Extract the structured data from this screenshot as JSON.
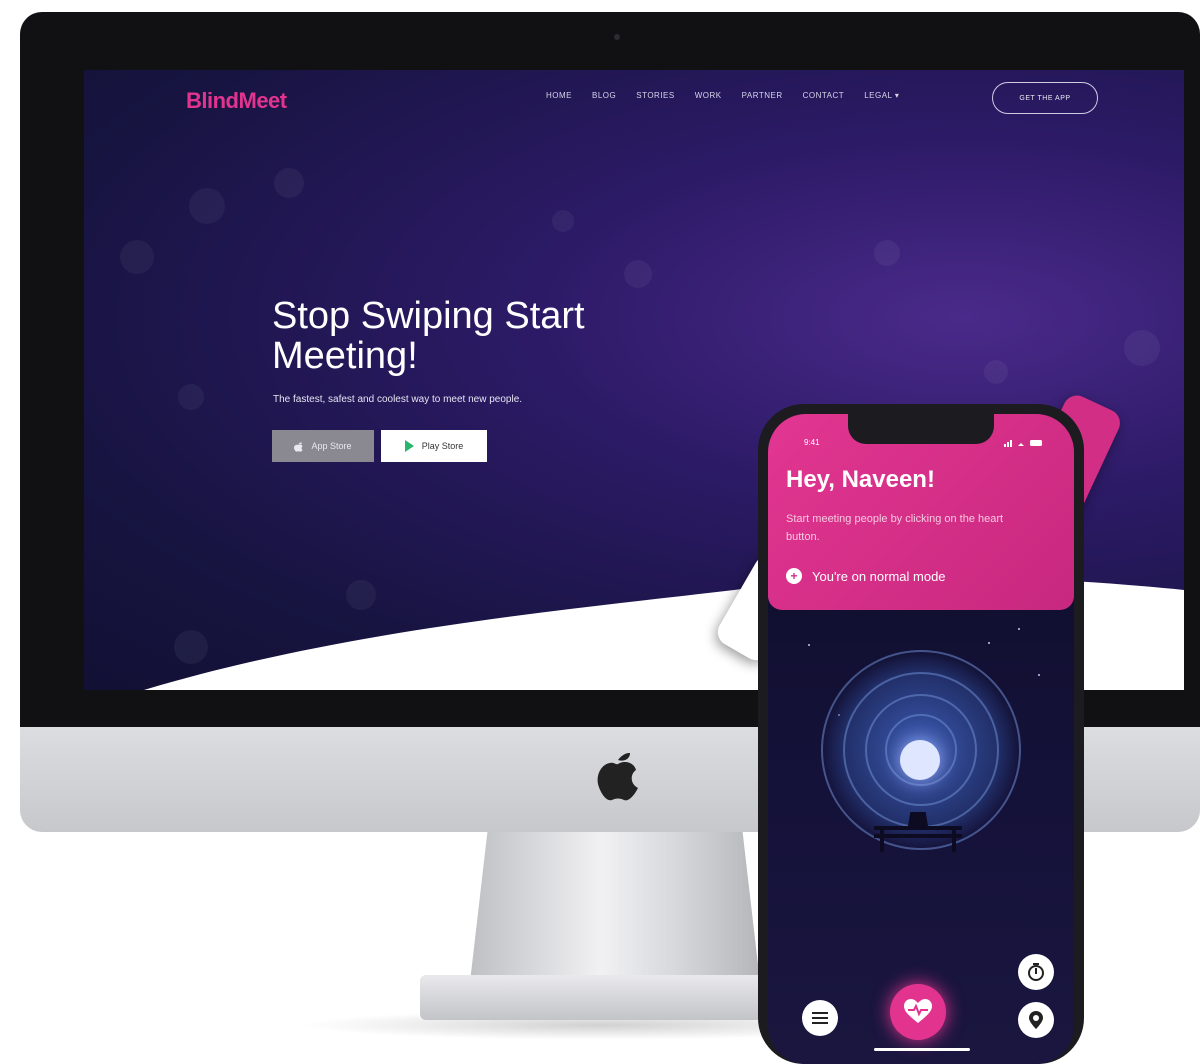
{
  "website": {
    "brand": "BlindMeet",
    "nav": [
      "HOME",
      "BLOG",
      "STORIES",
      "WORK",
      "PARTNER",
      "CONTACT",
      "LEGAL ▾"
    ],
    "cta": "GET THE APP",
    "hero_title": "Stop Swiping Start Meeting!",
    "hero_subtitle": "The fastest, safest and coolest way to meet new people.",
    "app_store_label": "App Store",
    "play_store_label": "Play Store"
  },
  "phone": {
    "status_time": "9:41",
    "greeting": "Hey, Naveen!",
    "subtext": "Start meeting people by clicking on the heart button.",
    "mode_label": "You're on normal mode",
    "icons": [
      "menu-icon",
      "heart-icon",
      "timer-icon",
      "location-icon"
    ]
  },
  "colors": {
    "accent": "#e2348f",
    "screen_bg": "#171441",
    "phone_card": "#d22e86"
  }
}
